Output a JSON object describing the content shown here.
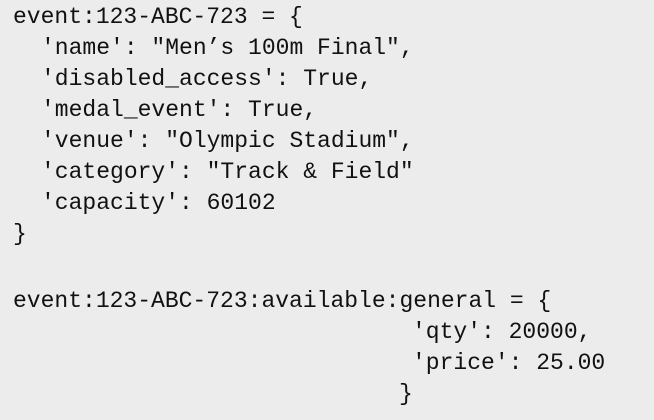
{
  "block1": {
    "header": "event:123-ABC-723 = {",
    "lines": [
      "'name': \"Men’s 100m Final\",",
      "'disabled_access': True,",
      "'medal_event': True,",
      "'venue': \"Olympic Stadium\",",
      "'category': \"Track & Field\"",
      "'capacity': 60102"
    ],
    "footer": "}"
  },
  "block2": {
    "header": "event:123-ABC-723:available:general = {",
    "lines": [
      "'qty': 20000,",
      "'price': 25.00"
    ],
    "footer": "}"
  }
}
